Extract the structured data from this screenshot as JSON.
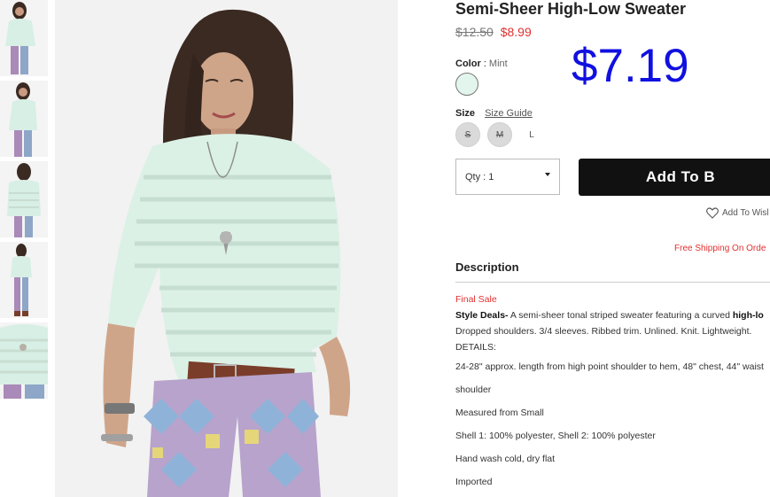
{
  "product": {
    "title": "Semi-Sheer High-Low Sweater",
    "original_price": "$12.50",
    "sale_price": "$8.99",
    "overlay_price": "$7.19"
  },
  "color": {
    "label": "Color",
    "separator": ":",
    "value": "Mint",
    "swatch_color": "#e3f6ee"
  },
  "size": {
    "label": "Size",
    "guide_label": "Size Guide",
    "options": [
      {
        "label": "S",
        "available": false
      },
      {
        "label": "M",
        "available": false
      },
      {
        "label": "L",
        "available": true
      }
    ]
  },
  "cart": {
    "qty_label": "Qty : 1",
    "add_button": "Add To B",
    "wishlist_label": "Add To Wisl",
    "free_shipping": "Free Shipping On Orde"
  },
  "description": {
    "heading": "Description",
    "final_sale": "Final Sale",
    "style_deals_label": "Style Deals-",
    "style_deals_text": " A semi-sheer tonal striped sweater featuring a curved ",
    "style_deals_bold": "high-lo",
    "line2": "Dropped shoulders. 3/4 sleeves. Ribbed trim. Unlined. Knit. Lightweight.",
    "details_label": "DETAILS:",
    "details": [
      "24-28\" approx. length from high point shoulder to hem, 48\" chest, 44\" waist",
      "shoulder",
      "Measured from Small",
      "Shell 1: 100% polyester, Shell 2: 100% polyester",
      "Hand wash cold, dry flat",
      "Imported"
    ]
  },
  "colors": {
    "accent_red": "#e03030",
    "overlay_blue": "#1010e0",
    "button_black": "#111111"
  }
}
